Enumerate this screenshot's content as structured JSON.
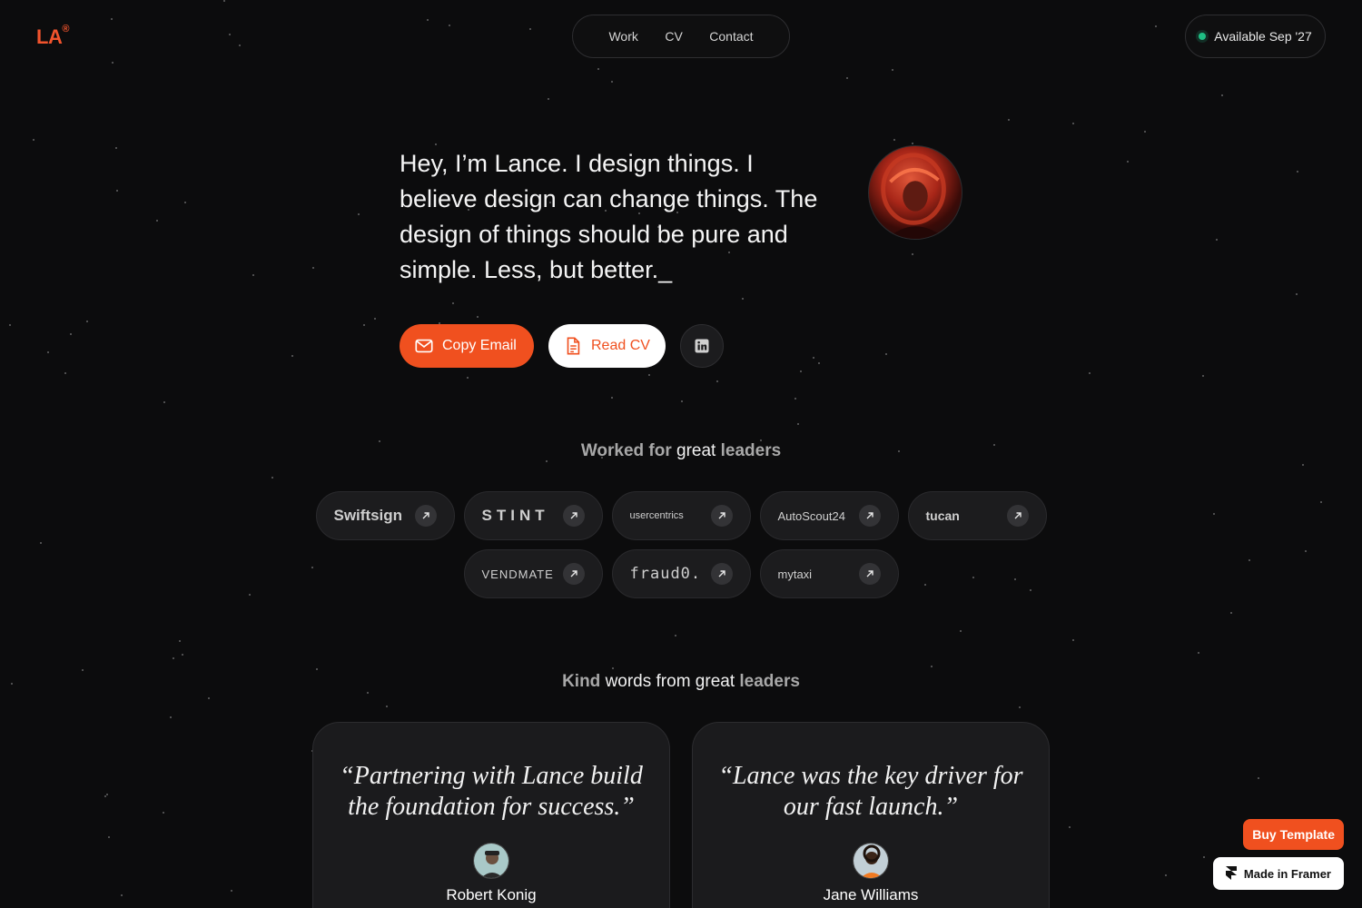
{
  "header": {
    "logo": "LA",
    "logo_mark": "®",
    "nav": [
      "Work",
      "CV",
      "Contact"
    ],
    "availability": "Available Sep '27"
  },
  "hero": {
    "intro": "Hey, I’m Lance. I design things. I believe design can change things. The design of things should be pure and simple. Less, but better._",
    "copy_email": "Copy Email",
    "read_cv": "Read CV",
    "linkedin_icon": "linkedin-icon"
  },
  "leaders": {
    "title_muted": "Worked for ",
    "title_bold": "great",
    "title_end": " leaders",
    "companies": [
      "Swiftsign",
      "STINT",
      "usercentrics",
      "AutoScout24",
      "tucan",
      "VENDMATE",
      "fraud0.",
      "mytaxi"
    ]
  },
  "testimonials": {
    "title_start": "Kind ",
    "title_bold": "words from great",
    "title_end": " leaders",
    "items": [
      {
        "quote": "“Partnering with Lance build the foundation for success.”",
        "name": "Robert Konig"
      },
      {
        "quote": "“Lance was the key driver for our fast launch.”",
        "name": "Jane Williams"
      }
    ]
  },
  "badges": {
    "buy": "Buy Template",
    "framer": "Made in Framer"
  },
  "colors": {
    "accent": "#f0501f",
    "background": "#0c0c0d",
    "status": "#1fbf84"
  }
}
